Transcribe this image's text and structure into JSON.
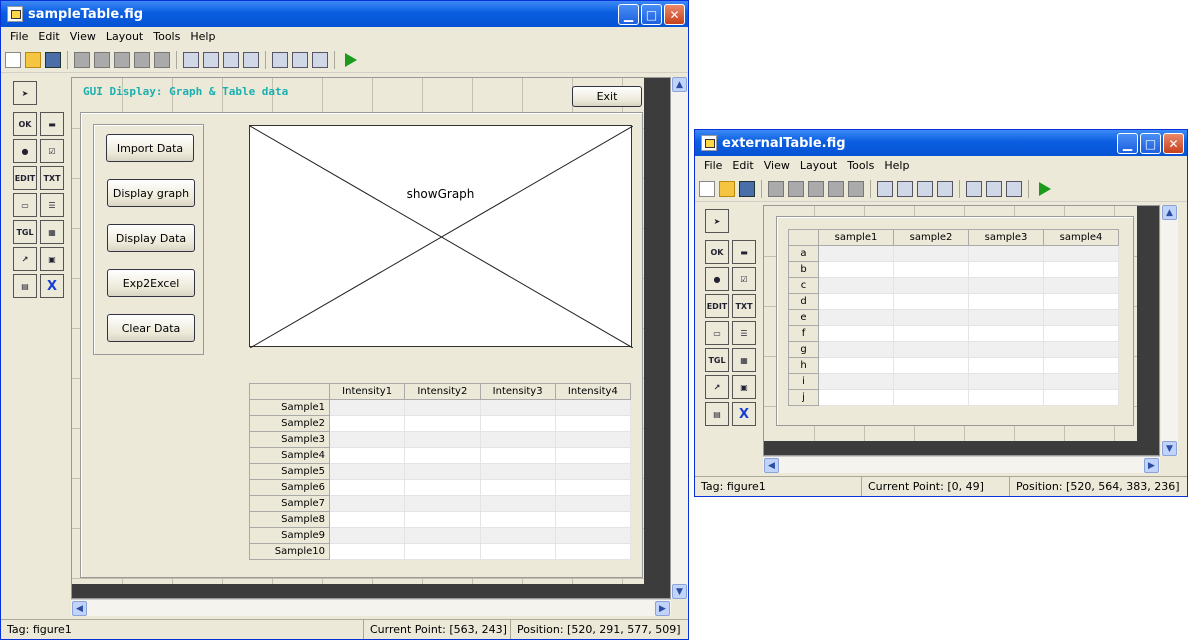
{
  "main_window": {
    "title": "sampleTable.fig",
    "menu": [
      "File",
      "Edit",
      "View",
      "Layout",
      "Tools",
      "Help"
    ],
    "gui_title": "GUI Display: Graph & Table data",
    "exit_label": "Exit",
    "buttons": [
      "Import Data",
      "Display graph",
      "Display Data",
      "Exp2Excel",
      "Clear Data"
    ],
    "axes_label": "showGraph",
    "table": {
      "columns": [
        "Intensity1",
        "Intensity2",
        "Intensity3",
        "Intensity4"
      ],
      "rows": [
        "Sample1",
        "Sample2",
        "Sample3",
        "Sample4",
        "Sample5",
        "Sample6",
        "Sample7",
        "Sample8",
        "Sample9",
        "Sample10"
      ]
    },
    "status": {
      "tag": "Tag: figure1",
      "current": "Current Point:  [563, 243]",
      "position": "Position: [520, 291, 577, 509]"
    }
  },
  "external_window": {
    "title": "externalTable.fig",
    "menu": [
      "File",
      "Edit",
      "View",
      "Layout",
      "Tools",
      "Help"
    ],
    "table": {
      "columns": [
        "sample1",
        "sample2",
        "sample3",
        "sample4"
      ],
      "rows": [
        "a",
        "b",
        "c",
        "d",
        "e",
        "f",
        "g",
        "h",
        "i",
        "j"
      ]
    },
    "status": {
      "tag": "Tag: figure1",
      "current": "Current Point:  [0, 49]",
      "position": "Position: [520, 564, 383, 236]"
    }
  },
  "palette_icons": [
    "pointer-icon",
    "pushbutton-icon",
    "slider-icon",
    "radiobutton-icon",
    "checkbox-icon",
    "edit-text-icon",
    "static-text-icon",
    "popup-menu-icon",
    "listbox-icon",
    "toggle-button-icon",
    "table-icon",
    "axes-icon",
    "panel-icon",
    "button-group-icon",
    "activex-icon"
  ],
  "palette_labels": [
    "OK",
    "▬",
    "●",
    "☑",
    "EDIT",
    "TXT",
    "▭",
    "☰",
    "TGL",
    "▦",
    "↗",
    "▣",
    "▤",
    "X"
  ]
}
